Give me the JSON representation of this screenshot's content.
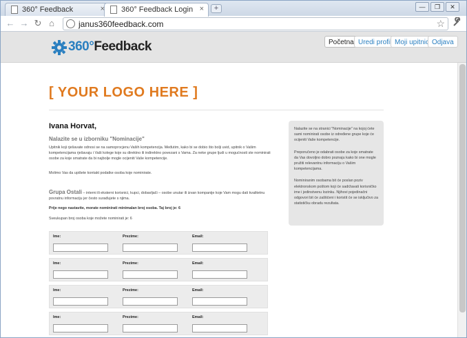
{
  "browser": {
    "tabs": [
      {
        "title": "360° Feedback",
        "close": "×"
      },
      {
        "title": "360° Feedback Login",
        "close": "×"
      }
    ],
    "new_tab": "+",
    "window_controls": [
      "—",
      "❐",
      "✕"
    ],
    "nav": {
      "back": "←",
      "forward": "→",
      "reload": "↻",
      "home": "⌂"
    },
    "url": "janus360feedback.com",
    "star": "☆",
    "wrench": "🔧"
  },
  "site": {
    "brand_num": "360°",
    "brand_text": "Feedback",
    "nav": [
      {
        "label": "Početna",
        "active": true
      },
      {
        "label": "Uredi profil",
        "active": false
      },
      {
        "label": "Moji upitnici",
        "active": false
      },
      {
        "label": "Odjava",
        "active": false
      }
    ]
  },
  "main": {
    "logo_placeholder": "[ YOUR LOGO HERE ]",
    "greeting": "Ivana Horvat,",
    "section_title": "Nalazite se u izborniku \"Nominacije\"",
    "intro_1": "Upitnik koji rješavate odnosi se na samoprocjenu Vaših kompetencija. Međutim, kako bi se dobio što bolji uvid, upitnik o Vašim kompetencijama rješavaju i Vaši kolege koje su direktno ili indirektno povezani s Vama. Za neke grupe ljudi u mogućnosti ste nominirati osobe za koje smatrate da bi najbolje mogle ocijeniti Vaše kompetencije.",
    "intro_2": "Molimo Vas da upišete kontakt podatke osoba koje nominirate.",
    "group_title": "Grupa Ostali",
    "group_desc": " – interni ili eksterni korisnici, kupci, dobavljači – osobe unutar ili izvan kompanije koje Vam mogu dati kvalitetnu povratnu informaciju jer često surađujete s njima.",
    "min_note": "Prije nego nastavite, morate nominirati minimalan broj osoba. Taj broj je: 6",
    "total_note": "Sveukupan broj osoba koje možete nominirati je: 6"
  },
  "sidebar": {
    "p1": "Nalazite se na stranici \"Nominacije\" na kojoj ćete sami nominirati osobe iz određene grupe koje će ocijeniti Vaše kompetencije.",
    "p2": "Preporučeno je odabrati osobe za koje smatrate da Vas dovoljno dobro poznaju kako bi one mogle pružiti relevantnu informaciju o Vašim kompetencijama.",
    "p3": "Nominiranim osobama bit će poslan poziv elektronskom poštom koji će sadržavati korisničko ime i jedinstvenu lozinku. Njihovi pojedinačni odgovori bit će zaštićeni i koristit će se isključivo za statističku obradu rezultata."
  },
  "form": {
    "labels": {
      "name": "Ime:",
      "surname": "Prezime:",
      "email": "Email:"
    },
    "rows": [
      {
        "name": "",
        "surname": "",
        "email": ""
      },
      {
        "name": "",
        "surname": "",
        "email": ""
      },
      {
        "name": "",
        "surname": "",
        "email": ""
      },
      {
        "name": "",
        "surname": "",
        "email": ""
      }
    ]
  },
  "colors": {
    "accent": "#e07a1f",
    "brand_blue": "#2a7fc0",
    "header_bg": "#e4e4e4"
  }
}
